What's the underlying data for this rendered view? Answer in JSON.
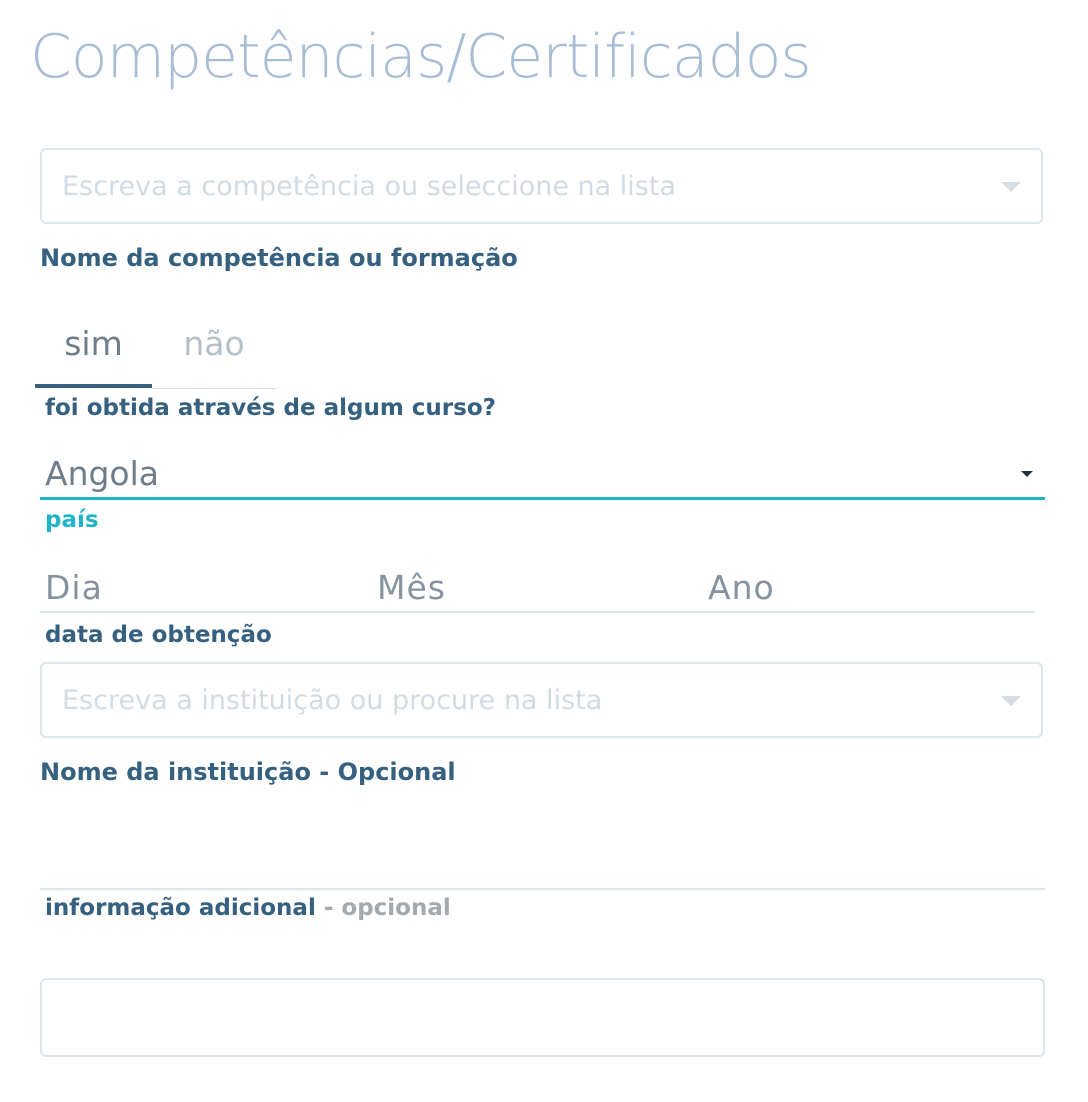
{
  "page": {
    "title": "Competências/Certificados"
  },
  "competence": {
    "placeholder": "Escreva a competência ou seleccione na lista",
    "label": "Nome da competência ou formação"
  },
  "course": {
    "tabs": [
      {
        "label": "sim",
        "selected": true
      },
      {
        "label": "não",
        "selected": false
      }
    ],
    "question": "foi obtida através de algum curso?"
  },
  "country": {
    "value": "Angola",
    "label": "país"
  },
  "date": {
    "day": "Dia",
    "month": "Mês",
    "year": "Ano",
    "label": "data de obtenção"
  },
  "institution": {
    "placeholder": "Escreva a instituição ou procure na lista",
    "label": "Nome da instituição - Opcional"
  },
  "additional": {
    "value": "",
    "label": "informação adicional",
    "optional_suffix": "- opcional"
  },
  "extra_field": {
    "value": ""
  },
  "colors": {
    "title": "#a7bdd6",
    "label": "#35607f",
    "accent": "#1fb5c9",
    "border": "#dde4ea",
    "placeholder": "#d2dbe3",
    "muted": "#a4a9ad"
  },
  "icons": {
    "dropdown": "chevron-down-icon"
  }
}
